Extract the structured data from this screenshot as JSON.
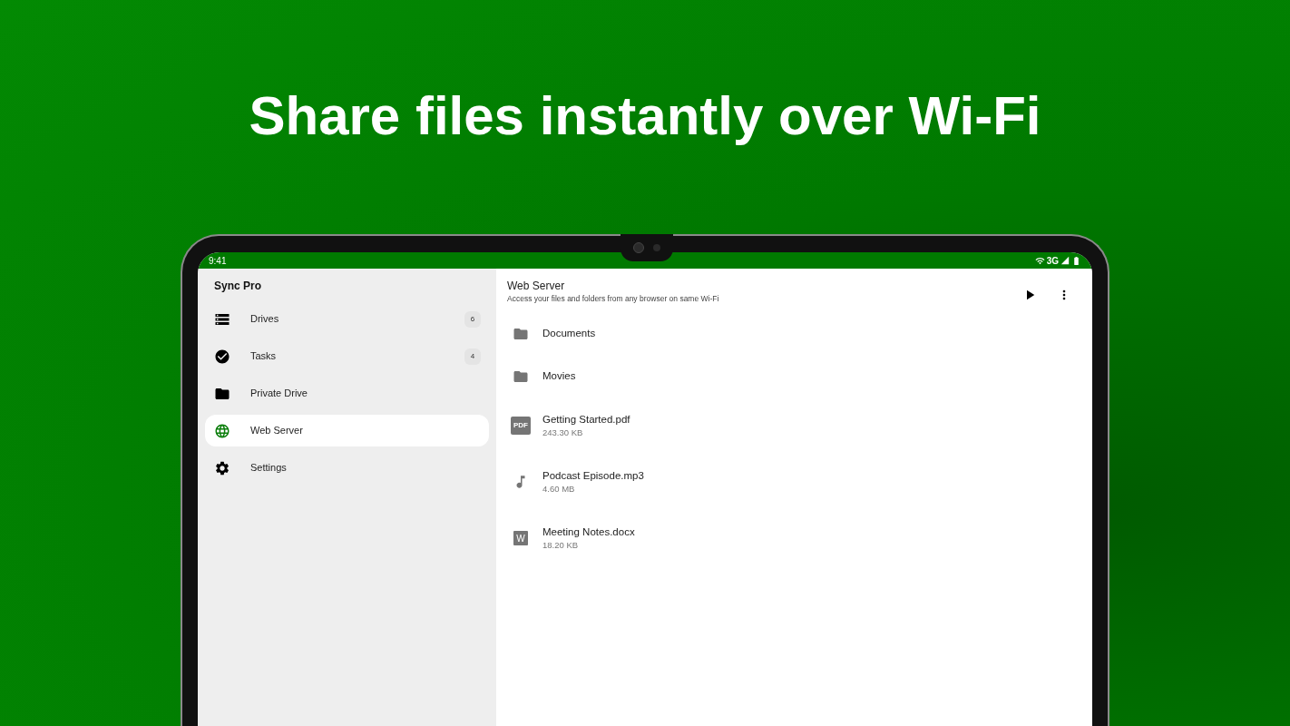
{
  "headline": "Share files instantly over Wi-Fi",
  "status_bar": {
    "time": "9:41",
    "network": "3G"
  },
  "sidebar": {
    "title": "Sync Pro",
    "items": [
      {
        "kind": "drives",
        "label": "Drives",
        "count": "6",
        "selected": false
      },
      {
        "kind": "tasks",
        "label": "Tasks",
        "count": "4",
        "selected": false
      },
      {
        "kind": "folder",
        "label": "Private Drive",
        "selected": false
      },
      {
        "kind": "globe",
        "label": "Web Server",
        "selected": true
      },
      {
        "kind": "settings",
        "label": "Settings",
        "selected": false
      }
    ]
  },
  "main": {
    "title": "Web Server",
    "subtitle": "Access your files and folders from any browser on same Wi-Fi",
    "files": [
      {
        "kind": "folder",
        "name": "Documents"
      },
      {
        "kind": "folder",
        "name": "Movies"
      },
      {
        "kind": "pdf",
        "badge": "PDF",
        "name": "Getting Started.pdf",
        "size": "243.30 KB"
      },
      {
        "kind": "audio",
        "name": "Podcast Episode.mp3",
        "size": "4.60 MB"
      },
      {
        "kind": "doc",
        "badge": "W",
        "name": "Meeting Notes.docx",
        "size": "18.20 KB"
      }
    ]
  }
}
